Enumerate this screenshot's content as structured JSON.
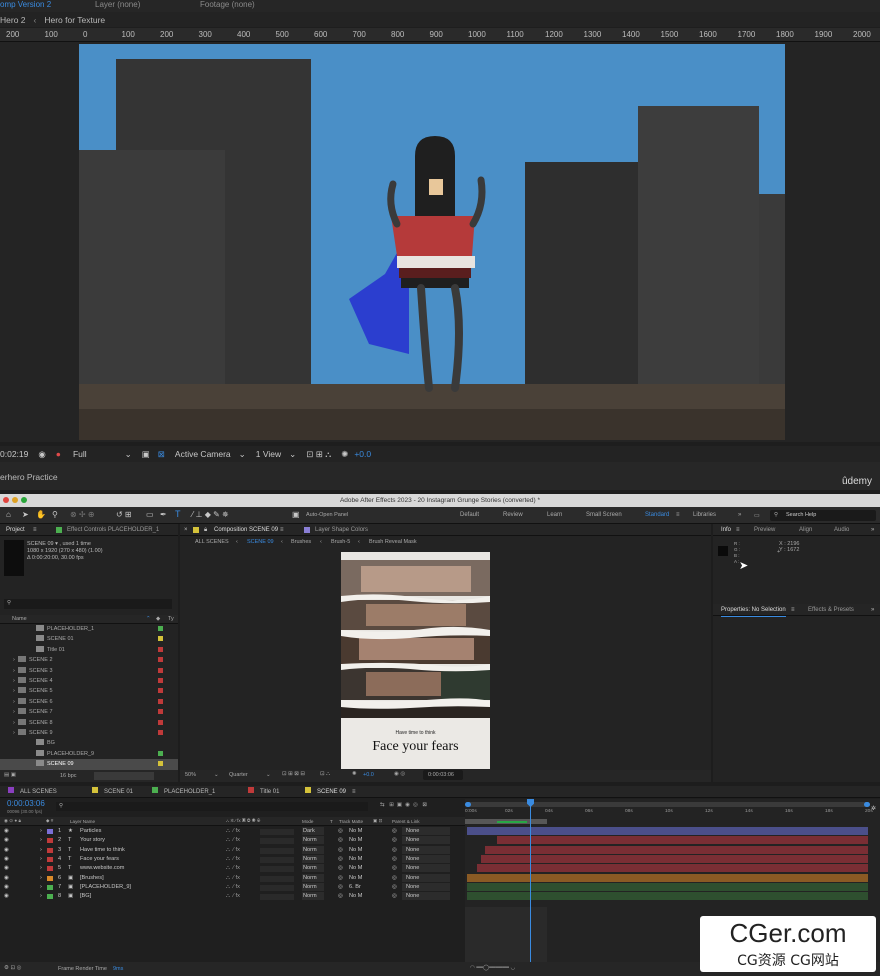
{
  "top_tabs": {
    "comp": "omp Version 2",
    "layer": "Layer (none)",
    "footage": "Footage (none)"
  },
  "top_crumbs": {
    "a": "Hero 2",
    "b": "Hero for Texture"
  },
  "ruler_ticks": [
    "200",
    "100",
    "0",
    "100",
    "200",
    "300",
    "400",
    "500",
    "600",
    "700",
    "800",
    "900",
    "1000",
    "1100",
    "1200",
    "1300",
    "1400",
    "1500",
    "1600",
    "1700",
    "1800",
    "1900",
    "2000",
    "21"
  ],
  "top_toolbar": {
    "time": "0:02:19",
    "res": "Full",
    "camera": "Active Camera",
    "view": "1 View",
    "exposure": "+0.0"
  },
  "top_panel": {
    "label": "erhero Practice",
    "watermark": "ûdemy"
  },
  "ae": {
    "title": "Adobe After Effects 2023 - 20 Instagram Grunge Stories (converted) *",
    "auto_open": "Auto-Open Panel",
    "workspaces": [
      "Default",
      "Review",
      "Learn",
      "Small Screen",
      "Standard",
      "Libraries"
    ],
    "search": "Search Help",
    "project_tab": "Project",
    "effect_tab": "Effect Controls PLACEHOLDER_1",
    "project_info": [
      "SCENE 09 ▾ , used 1 time",
      "1080 x 1920  (270 x 480) (1.00)",
      "Δ 0:00:20:00, 30.00 fps"
    ],
    "project_col": "Name",
    "project_items": [
      {
        "name": "PLACEHOLDER_1",
        "color": "#4caf50",
        "indent": 2,
        "type": "comp"
      },
      {
        "name": "SCENE 01",
        "color": "#d4c23a",
        "indent": 2,
        "type": "comp"
      },
      {
        "name": "Title 01",
        "color": "#c03a3a",
        "indent": 2,
        "type": "comp"
      },
      {
        "name": "SCENE 2",
        "color": "#c03a3a",
        "indent": 1,
        "type": "folder"
      },
      {
        "name": "SCENE 3",
        "color": "#c03a3a",
        "indent": 1,
        "type": "folder"
      },
      {
        "name": "SCENE 4",
        "color": "#c03a3a",
        "indent": 1,
        "type": "folder"
      },
      {
        "name": "SCENE 5",
        "color": "#c03a3a",
        "indent": 1,
        "type": "folder"
      },
      {
        "name": "SCENE 6",
        "color": "#c03a3a",
        "indent": 1,
        "type": "folder"
      },
      {
        "name": "SCENE 7",
        "color": "#c03a3a",
        "indent": 1,
        "type": "folder"
      },
      {
        "name": "SCENE 8",
        "color": "#c03a3a",
        "indent": 1,
        "type": "folder"
      },
      {
        "name": "SCENE 9",
        "color": "#c03a3a",
        "indent": 1,
        "type": "folder"
      },
      {
        "name": "BG",
        "color": "",
        "indent": 2,
        "type": "comp"
      },
      {
        "name": "PLACEHOLDER_9",
        "color": "#4caf50",
        "indent": 2,
        "type": "comp"
      },
      {
        "name": "SCENE 09",
        "color": "#d4c23a",
        "indent": 2,
        "type": "comp"
      }
    ],
    "bpc": "16 bpc",
    "comp_tab": "Composition SCENE 09",
    "layer_tab": "Layer Shape Colors",
    "flow": [
      "ALL SCENES",
      "SCENE 09",
      "Brushes",
      "Brush-5",
      "Brush Reveal Mask"
    ],
    "comp_text_small": "Have time to think",
    "comp_text_big": "Face your fears",
    "comp_bar": {
      "zoom": "50%",
      "res": "Quarter",
      "exposure": "+0.0",
      "time": "0:00:03:06"
    },
    "info_tabs": [
      "Info",
      "Preview",
      "Align",
      "Audio"
    ],
    "info_rgb": [
      "R :",
      "G :",
      "B :",
      "A :"
    ],
    "info_xy": [
      "X : 2196",
      "Y : 1672"
    ],
    "props_tab": "Properties: No Selection",
    "effects_tab": "Effects & Presets",
    "timeline_tabs": [
      {
        "label": "ALL SCENES",
        "color": "#8a3fbf"
      },
      {
        "label": "SCENE 01",
        "color": "#d4c23a"
      },
      {
        "label": "PLACEHOLDER_1",
        "color": "#4caf50"
      },
      {
        "label": "Title 01",
        "color": "#c03a3a"
      },
      {
        "label": "SCENE 09",
        "color": "#d4c23a"
      }
    ],
    "tl_time": "0:00:03:06",
    "tl_frames": "00096 (30.00 fps)",
    "tl_cols": {
      "name": "Layer Name",
      "mode": "Mode",
      "t": "T",
      "matte": "Track Matte",
      "parent": "Parent & Link"
    },
    "tl_ruler": [
      "0:00s",
      "02s",
      "04s",
      "06s",
      "08s",
      "10s",
      "12s",
      "14s",
      "16s",
      "18s",
      "20s"
    ],
    "layers": [
      {
        "num": "1",
        "name": "Particles",
        "color": "#7b6fd6",
        "mode": "Dark",
        "matte": "No M",
        "parent": "None",
        "type": "★"
      },
      {
        "num": "2",
        "name": "Your story",
        "color": "#c03a3a",
        "mode": "Norm",
        "matte": "No M",
        "parent": "None",
        "type": "T"
      },
      {
        "num": "3",
        "name": "Have time to think",
        "color": "#c03a3a",
        "mode": "Norm",
        "matte": "No M",
        "parent": "None",
        "type": "T"
      },
      {
        "num": "4",
        "name": "Face your fears",
        "color": "#c03a3a",
        "mode": "Norm",
        "matte": "No M",
        "parent": "None",
        "type": "T"
      },
      {
        "num": "5",
        "name": "www.website.com",
        "color": "#c03a3a",
        "mode": "Norm",
        "matte": "No M",
        "parent": "None",
        "type": "T"
      },
      {
        "num": "6",
        "name": "[Brushes]",
        "color": "#d98a2a",
        "mode": "Norm",
        "matte": "No M",
        "parent": "None",
        "type": "▣"
      },
      {
        "num": "7",
        "name": "[PLACEHOLDER_9]",
        "color": "#4caf50",
        "mode": "Norm",
        "matte": "6. Br",
        "parent": "None",
        "type": "▣"
      },
      {
        "num": "8",
        "name": "[BG]",
        "color": "#4caf50",
        "mode": "Norm",
        "matte": "No M",
        "parent": "None",
        "type": "▣"
      }
    ],
    "footer": {
      "render": "Frame Render Time",
      "render_val": "9ms"
    }
  },
  "watermark": {
    "big": "CGer.com",
    "small": "CG资源 CG网站"
  }
}
